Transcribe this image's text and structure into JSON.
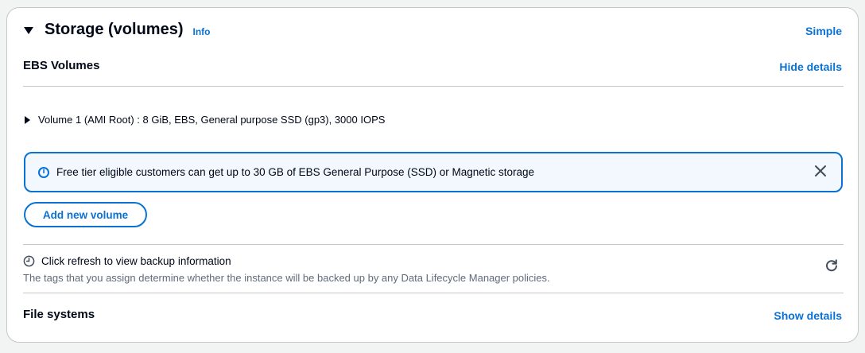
{
  "section": {
    "title": "Storage (volumes)",
    "info_label": "Info",
    "mode_link": "Simple"
  },
  "ebs": {
    "title": "EBS Volumes",
    "details_toggle": "Hide details",
    "volume_summary": "Volume 1 (AMI Root) : 8 GiB, EBS, General purpose SSD (gp3), 3000 IOPS"
  },
  "alert": {
    "text": "Free tier eligible customers can get up to 30 GB of EBS General Purpose (SSD) or Magnetic storage"
  },
  "add_volume_label": "Add new volume",
  "backup": {
    "heading": "Click refresh to view backup information",
    "description": "The tags that you assign determine whether the instance will be backed up by any Data Lifecycle Manager policies."
  },
  "file_systems": {
    "title": "File systems",
    "details_toggle": "Show details"
  },
  "colors": {
    "accent": "#0972d3",
    "text": "#000716",
    "muted": "#5f6b7a",
    "alert_bg": "#f2f8fd"
  }
}
